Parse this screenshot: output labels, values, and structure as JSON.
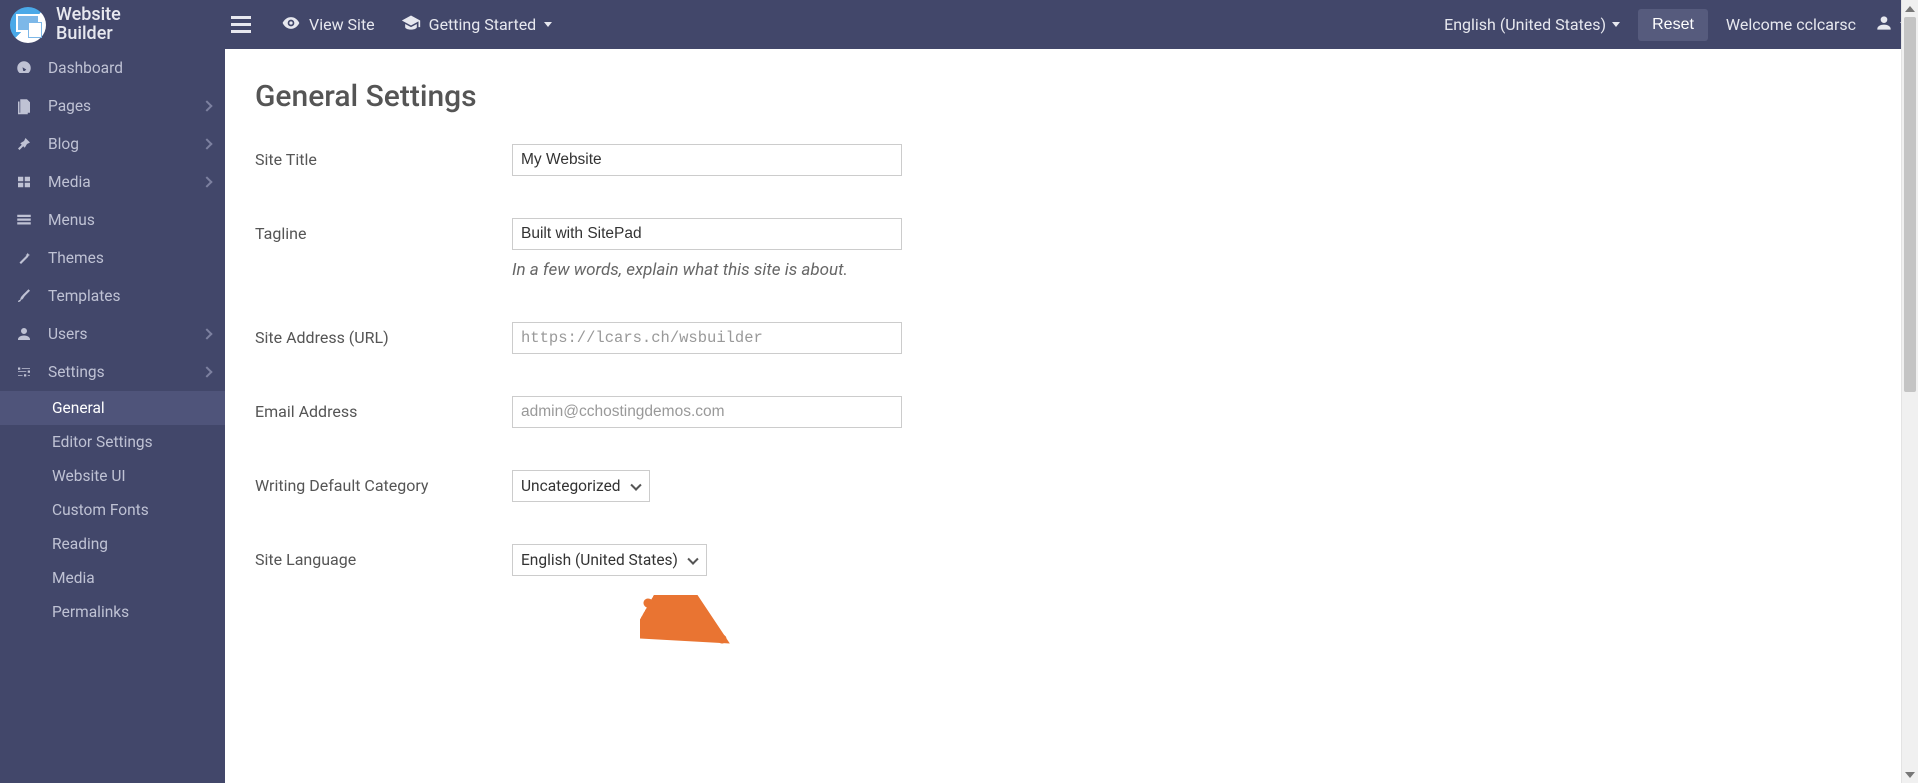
{
  "brand": {
    "line1": "Website",
    "line2": "Builder"
  },
  "topbar": {
    "view_site": "View Site",
    "getting_started": "Getting Started",
    "language": "English (United States)",
    "reset": "Reset",
    "welcome": "Welcome cclcarsc"
  },
  "sidebar": {
    "dashboard": "Dashboard",
    "pages": "Pages",
    "blog": "Blog",
    "media": "Media",
    "menus": "Menus",
    "themes": "Themes",
    "templates": "Templates",
    "users": "Users",
    "settings": "Settings",
    "sub": {
      "general": "General",
      "editor_settings": "Editor Settings",
      "website_ui": "Website UI",
      "custom_fonts": "Custom Fonts",
      "reading": "Reading",
      "media": "Media",
      "permalinks": "Permalinks"
    }
  },
  "page": {
    "title": "General Settings",
    "fields": {
      "site_title": {
        "label": "Site Title",
        "value": "My Website"
      },
      "tagline": {
        "label": "Tagline",
        "value": "Built with SitePad",
        "help": "In a few words, explain what this site is about."
      },
      "site_address": {
        "label": "Site Address (URL)",
        "value": "https://lcars.ch/wsbuilder"
      },
      "email": {
        "label": "Email Address",
        "value": "admin@cchostingdemos.com"
      },
      "default_category": {
        "label": "Writing Default Category",
        "value": "Uncategorized"
      },
      "site_language": {
        "label": "Site Language",
        "value": "English (United States)"
      }
    }
  }
}
